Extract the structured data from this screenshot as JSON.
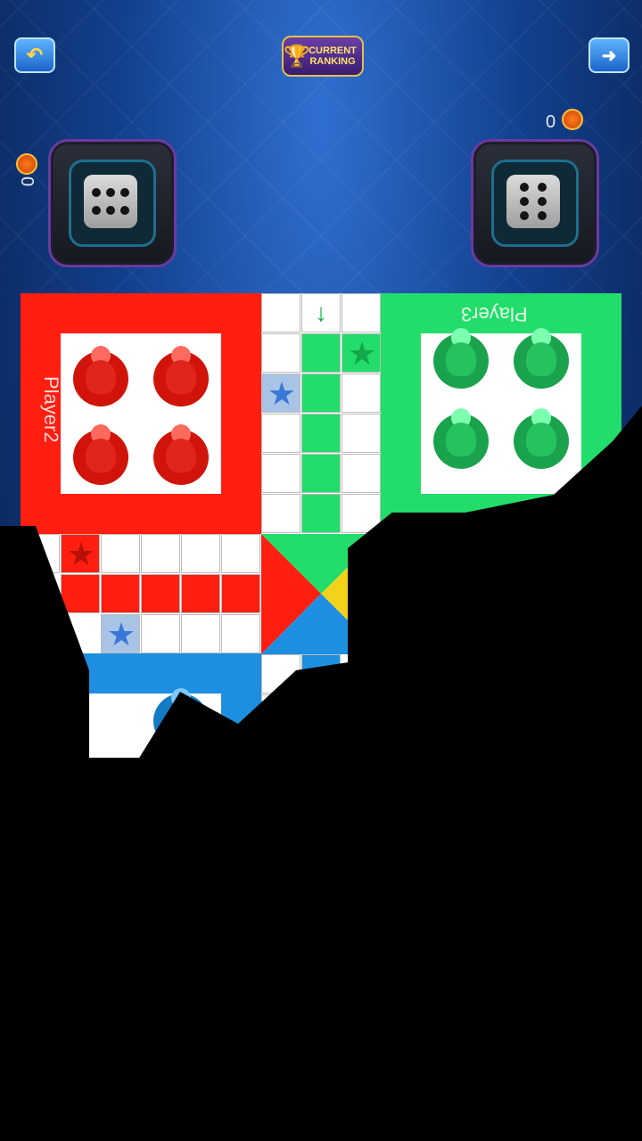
{
  "header": {
    "back_icon": "back-arrow-icon",
    "ranking_label_line1": "CURRENT",
    "ranking_label_line2": "RANKING",
    "exit_icon": "exit-runner-icon"
  },
  "players": {
    "left": {
      "score": "0",
      "dice_face": 6
    },
    "right": {
      "score": "0",
      "dice_face": 6
    }
  },
  "board": {
    "red_label": "Player2",
    "green_label": "Player3",
    "colors": {
      "red": "#ff1e10",
      "green": "#22dd6a",
      "blue": "#1e8fe0",
      "yellow": "#f2d21a"
    }
  }
}
